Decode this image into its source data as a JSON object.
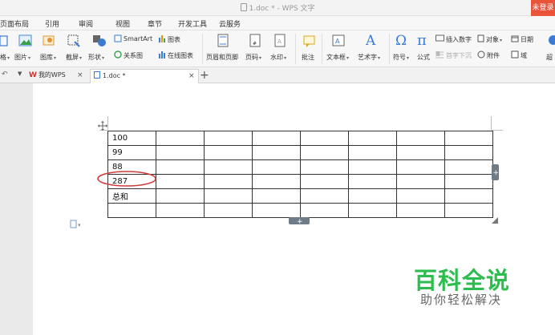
{
  "window": {
    "title": "1.doc * - WPS 文字",
    "login_label": "未登录"
  },
  "menu": [
    "页面布局",
    "引用",
    "审阅",
    "视图",
    "章节",
    "开发工具",
    "云服务"
  ],
  "ribbon": {
    "items": [
      "格",
      "图片",
      "图库",
      "截屏",
      "形状",
      "SmartArt",
      "图表",
      "关系图",
      "在线图表",
      "页眉和页脚",
      "页码",
      "水印",
      "批注",
      "文本框",
      "艺术字",
      "符号",
      "公式",
      "插入数字",
      "对象",
      "日期",
      "首字下沉",
      "附件",
      "域",
      "超"
    ]
  },
  "tabs": {
    "home_label": "我的WPS",
    "doc_label": "1.doc *"
  },
  "document": {
    "table_rows": [
      [
        "100",
        "",
        "",
        "",
        "",
        "",
        "",
        ""
      ],
      [
        "99",
        "",
        "",
        "",
        "",
        "",
        "",
        ""
      ],
      [
        "88",
        "",
        "",
        "",
        "",
        "",
        "",
        ""
      ],
      [
        "287",
        "",
        "",
        "",
        "",
        "",
        "",
        ""
      ],
      [
        "总和",
        "",
        "",
        "",
        "",
        "",
        "",
        ""
      ],
      [
        "",
        "",
        "",
        "",
        "",
        "",
        "",
        ""
      ]
    ],
    "highlighted_value": "287"
  },
  "watermark": {
    "title": "百科全说",
    "subtitle": "助你轻松解决"
  },
  "colors": {
    "accent_orange": "#e8533a",
    "highlight_red": "#d13b3b",
    "watermark_green": "#2dbd4f"
  }
}
